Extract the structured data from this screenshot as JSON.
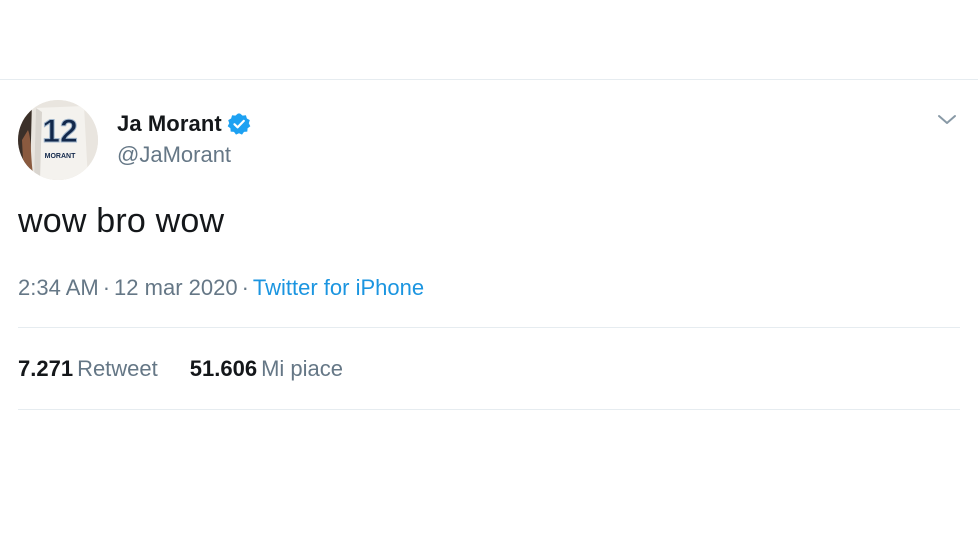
{
  "tweet": {
    "author": {
      "name": "Ja Morant",
      "handle": "@JaMorant",
      "verified": true,
      "avatar_icon": "jersey-avatar",
      "jersey_number": "12",
      "jersey_name": "MORANT"
    },
    "text": "wow bro wow",
    "time": "2:34 AM",
    "separator": "·",
    "date": "12 mar 2020",
    "source": "Twitter for iPhone",
    "retweets": {
      "count": "7.271",
      "label": "Retweet"
    },
    "likes": {
      "count": "51.606",
      "label": "Mi piace"
    }
  },
  "colors": {
    "text_primary": "#14171a",
    "text_secondary": "#657786",
    "accent": "#1b95e0",
    "divider": "#e6ecf0",
    "verified": "#1da1f2"
  },
  "icons": {
    "verified": "verified-badge-icon",
    "menu": "chevron-down-icon"
  }
}
